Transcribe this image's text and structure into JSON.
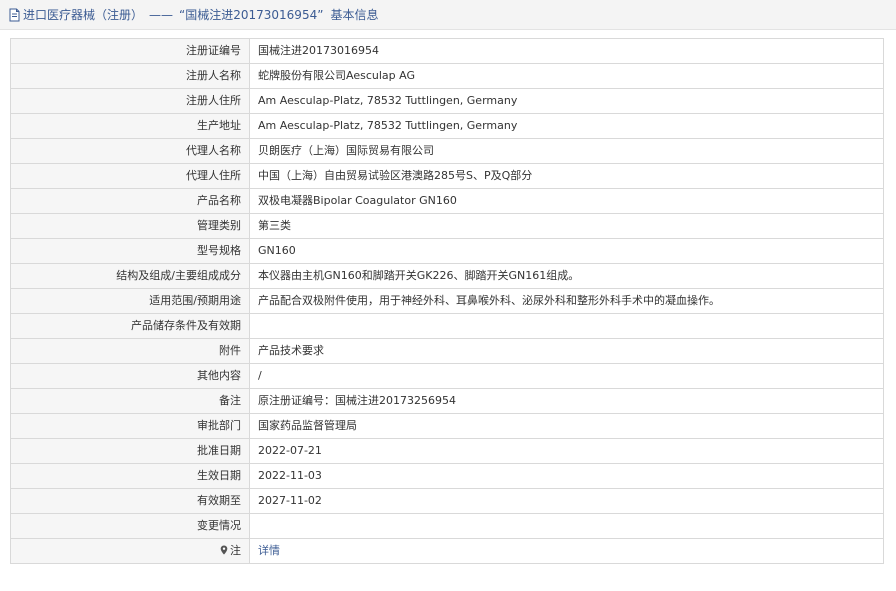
{
  "header": {
    "title_prefix": "进口医疗器械（注册）",
    "separator": "——",
    "title_name": "“国械注进20173016954”",
    "title_suffix": "基本信息"
  },
  "rows": [
    {
      "label": "注册证编号",
      "value": "国械注进20173016954"
    },
    {
      "label": "注册人名称",
      "value": "蛇牌股份有限公司Aesculap AG"
    },
    {
      "label": "注册人住所",
      "value": "Am Aesculap-Platz, 78532 Tuttlingen, Germany"
    },
    {
      "label": "生产地址",
      "value": "Am Aesculap-Platz, 78532 Tuttlingen, Germany"
    },
    {
      "label": "代理人名称",
      "value": "贝朗医疗（上海）国际贸易有限公司"
    },
    {
      "label": "代理人住所",
      "value": "中国（上海）自由贸易试验区港澳路285号S、P及Q部分"
    },
    {
      "label": "产品名称",
      "value": "双极电凝器Bipolar Coagulator GN160"
    },
    {
      "label": "管理类别",
      "value": "第三类"
    },
    {
      "label": "型号规格",
      "value": "GN160"
    },
    {
      "label": "结构及组成/主要组成成分",
      "value": "本仪器由主机GN160和脚踏开关GK226、脚踏开关GN161组成。"
    },
    {
      "label": "适用范围/预期用途",
      "value": "产品配合双极附件使用，用于神经外科、耳鼻喉外科、泌尿外科和整形外科手术中的凝血操作。"
    },
    {
      "label": "产品储存条件及有效期",
      "value": ""
    },
    {
      "label": "附件",
      "value": "产品技术要求"
    },
    {
      "label": "其他内容",
      "value": "/"
    },
    {
      "label": "备注",
      "value": "原注册证编号：国械注进20173256954"
    },
    {
      "label": "审批部门",
      "value": "国家药品监督管理局"
    },
    {
      "label": "批准日期",
      "value": "2022-07-21"
    },
    {
      "label": "生效日期",
      "value": "2022-11-03"
    },
    {
      "label": "有效期至",
      "value": "2027-11-02"
    },
    {
      "label": "变更情况",
      "value": ""
    }
  ],
  "note_row": {
    "label": "注",
    "link_text": "详情",
    "icon": "location-pin-icon"
  },
  "colors": {
    "link": "#3b5b93",
    "label_bg": "#f6f6f6",
    "border": "#d9d9d9",
    "header_bg": "#f4f4f4"
  }
}
